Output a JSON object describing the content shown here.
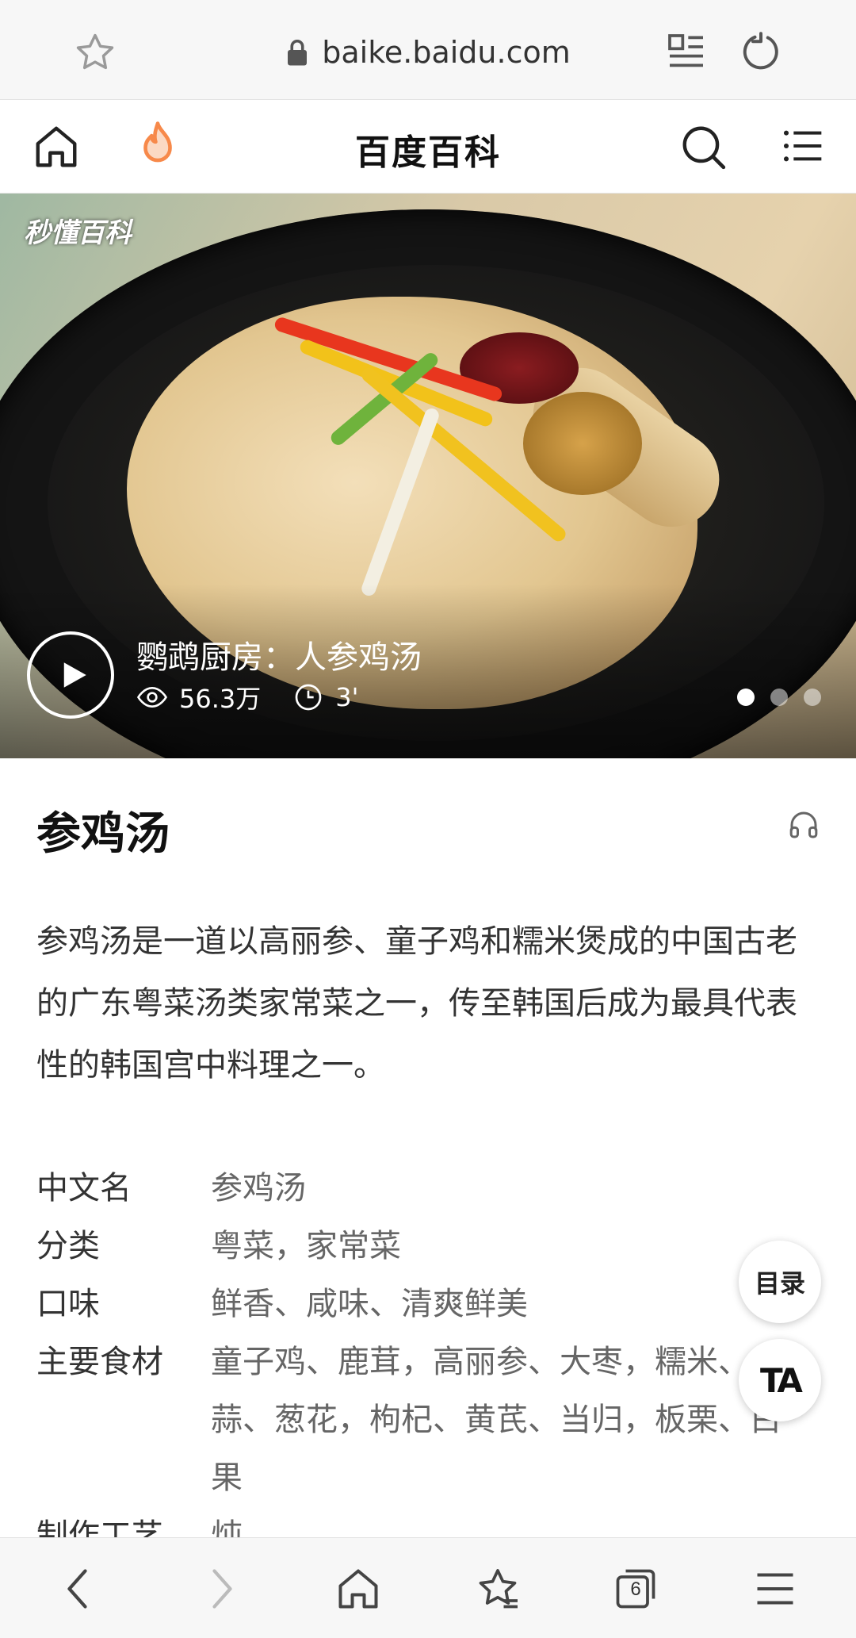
{
  "browser": {
    "url": "baike.baidu.com",
    "tab_count": "6"
  },
  "site_header": {
    "title": "百度百科"
  },
  "hero": {
    "watermark": "秒懂百科",
    "video_title": "鹦鹉厨房：人参鸡汤",
    "views": "56.3万",
    "duration": "3'",
    "slide_count": 3,
    "active_slide": 1
  },
  "article": {
    "title": "参鸡汤",
    "summary": "参鸡汤是一道以高丽参、童子鸡和糯米煲成的中国古老的广东粤菜汤类家常菜之一，传至韩国后成为最具代表性的韩国宫中料理之一。"
  },
  "info": [
    {
      "label": "中文名",
      "value": "参鸡汤"
    },
    {
      "label": "分类",
      "value": "粤菜，家常菜"
    },
    {
      "label": "口味",
      "value": "鲜香、咸味、清爽鲜美"
    },
    {
      "label": "主要食材",
      "value": "童子鸡、鹿茸，高丽参、大枣，糯米、大蒜、葱花，枸杞、黄芪、当归，板栗、白果"
    },
    {
      "label": "制作工艺",
      "value": "炖"
    }
  ],
  "float": {
    "toc_label": "目录",
    "font_label": "TA"
  },
  "icons": {
    "bookmark": "star-outline-icon",
    "lock": "lock-icon",
    "reader": "reader-mode-icon",
    "reload": "reload-icon",
    "home": "home-icon",
    "hot": "fire-icon",
    "search": "search-icon",
    "menu": "menu-icon",
    "play": "play-icon",
    "views": "eye-icon",
    "duration": "clock-icon",
    "audio": "headphones-icon",
    "back": "back-arrow-icon",
    "forward": "forward-arrow-icon",
    "bookmarks": "bookmarks-icon",
    "tabs": "tabs-icon"
  },
  "colors": {
    "accent_fire": "#f7894a",
    "disabled": "#bbbbbb"
  }
}
